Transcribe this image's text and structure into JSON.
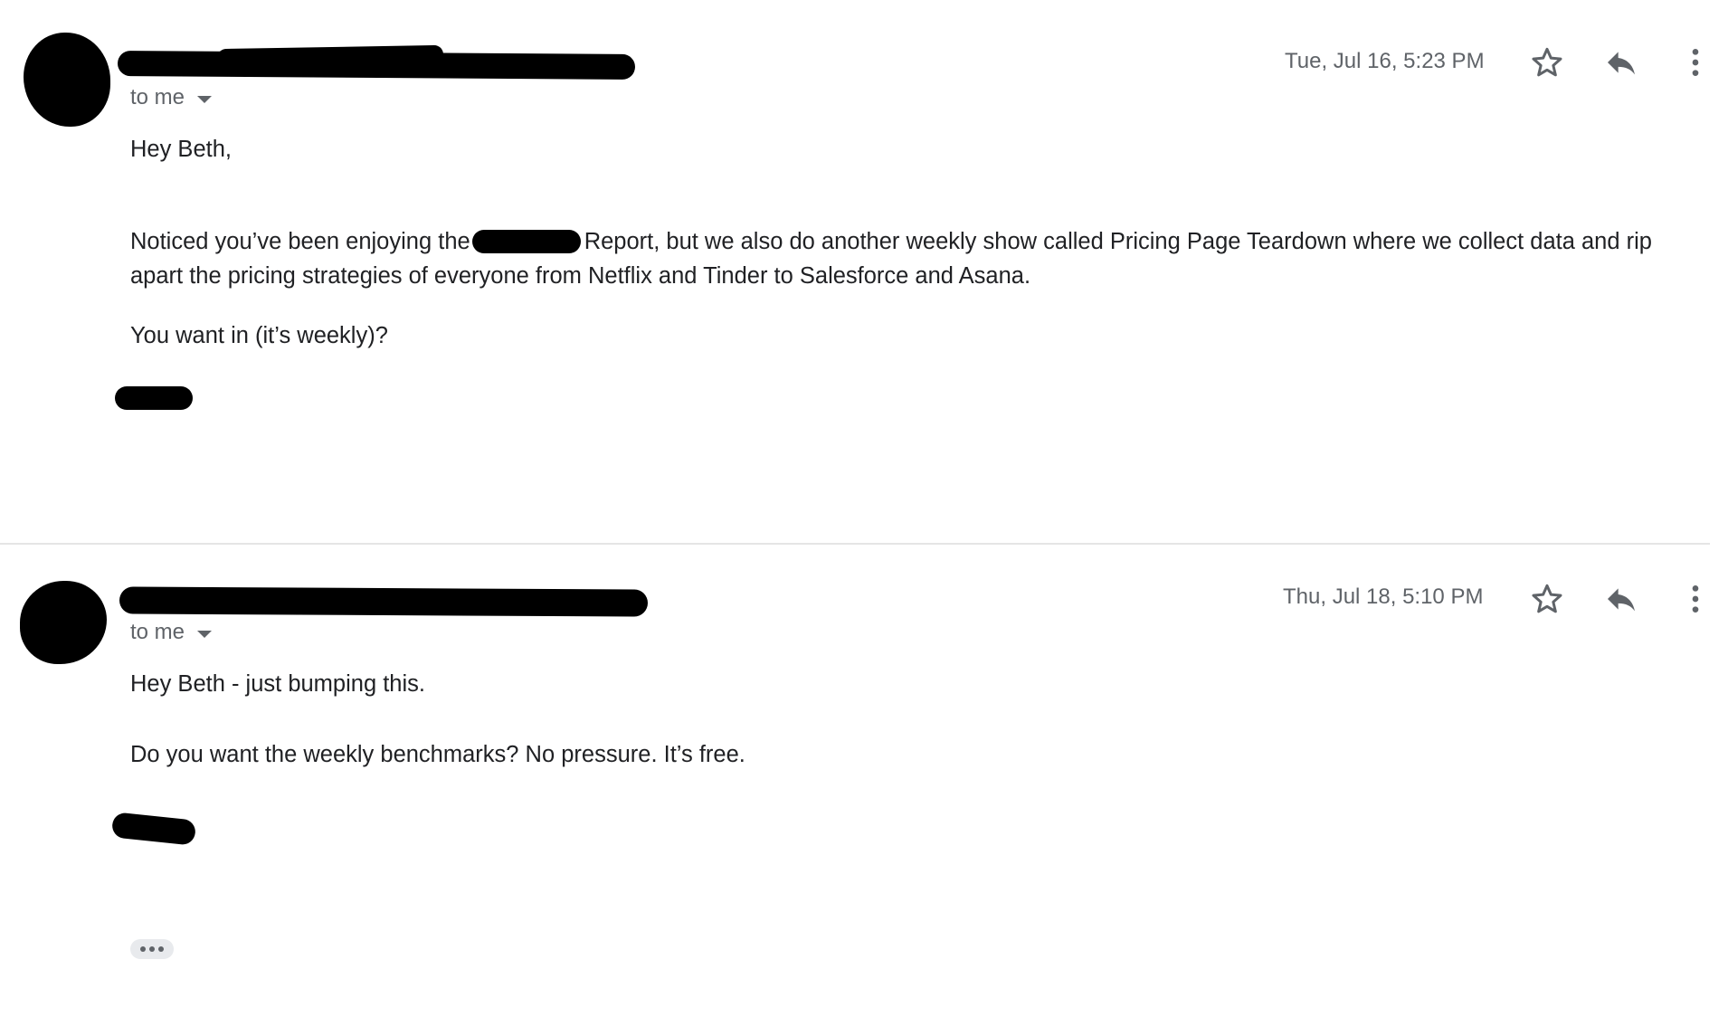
{
  "messages": [
    {
      "recipient_label": "to me",
      "date": "Tue, Jul 16, 5:23 PM",
      "body": {
        "greeting": "Hey Beth,",
        "p1_before": "Noticed you’ve been enjoying the",
        "p1_after": "Report, but we also do another weekly show called Pricing Page Teardown where we collect data and rip",
        "p1_line2": "apart the pricing strategies of everyone from Netflix and Tinder to Salesforce and Asana.",
        "p2": "You want in (it’s weekly)?"
      }
    },
    {
      "recipient_label": "to me",
      "date": "Thu, Jul 18, 5:10 PM",
      "body": {
        "greeting": "Hey Beth - just bumping this.",
        "p1": "Do you want the weekly benchmarks? No pressure. It’s free."
      }
    }
  ],
  "icons": {
    "star": "star-icon",
    "reply": "reply-icon",
    "more": "more-vert-icon",
    "caret": "caret-down-icon",
    "trimmed": "show-trimmed-content-icon"
  },
  "colors": {
    "icon_gray": "#5f6368",
    "text": "#202124",
    "divider": "#e5e5e5",
    "redaction": "#000000"
  }
}
